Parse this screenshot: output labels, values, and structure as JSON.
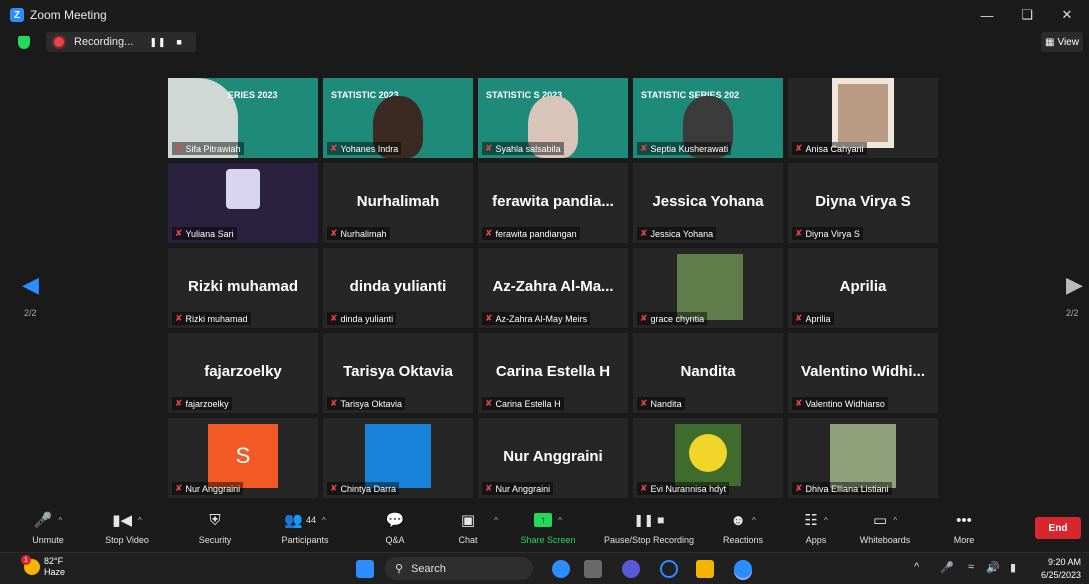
{
  "window": {
    "title": "Zoom Meeting"
  },
  "recording": {
    "label": "Recording..."
  },
  "view_button": {
    "label": "View"
  },
  "pagination": {
    "left": "2/2",
    "right": "2/2"
  },
  "participants": [
    {
      "label": "Sifa Pitrawiah",
      "display": "",
      "slide": "ERIES 2023",
      "kind": "slide"
    },
    {
      "label": "Yohanes Indra",
      "display": "",
      "slide": "STATISTIC  2023",
      "kind": "slide-person"
    },
    {
      "label": "Syahla salsabila",
      "display": "",
      "slide": "STATISTIC   S 2023",
      "kind": "slide-person"
    },
    {
      "label": "Septia Kusherawati",
      "display": "",
      "slide": "STATISTIC SERIES 202",
      "kind": "slide-person"
    },
    {
      "label": "Anisa Cahyani",
      "display": "",
      "slide": "",
      "kind": "photo"
    },
    {
      "label": "Yuliana Sari",
      "display": "",
      "slide": "",
      "kind": "dark"
    },
    {
      "label": "Nurhalimah",
      "display": "Nurhalimah",
      "slide": "",
      "kind": "name"
    },
    {
      "label": "ferawita pandiangan",
      "display": "ferawita pandia...",
      "slide": "",
      "kind": "name"
    },
    {
      "label": "Jessica Yohana",
      "display": "Jessica Yohana",
      "slide": "",
      "kind": "name"
    },
    {
      "label": "Diyna Virya S",
      "display": "Diyna Virya S",
      "slide": "",
      "kind": "name"
    },
    {
      "label": "Rizki muhamad",
      "display": "Rizki muhamad",
      "slide": "",
      "kind": "name"
    },
    {
      "label": "dinda yulianti",
      "display": "dinda yulianti",
      "slide": "",
      "kind": "name"
    },
    {
      "label": "Az-Zahra Al-May Meirs",
      "display": "Az-Zahra Al-Ma...",
      "slide": "",
      "kind": "name"
    },
    {
      "label": "grace chyntia",
      "display": "",
      "slide": "",
      "kind": "photo-green"
    },
    {
      "label": "Aprilia",
      "display": "Aprilia",
      "slide": "",
      "kind": "name"
    },
    {
      "label": "fajarzoelky",
      "display": "fajarzoelky",
      "slide": "",
      "kind": "name"
    },
    {
      "label": "Tarisya Oktavia",
      "display": "Tarisya Oktavia",
      "slide": "",
      "kind": "name"
    },
    {
      "label": "Carina Estella H",
      "display": "Carina Estella H",
      "slide": "",
      "kind": "name"
    },
    {
      "label": "Nandita",
      "display": "Nandita",
      "slide": "",
      "kind": "name"
    },
    {
      "label": "Valentino Widhiarso",
      "display": "Valentino Widhi...",
      "slide": "",
      "kind": "name"
    },
    {
      "label": "Nur Anggraini",
      "display": "",
      "slide": "S",
      "kind": "avatar-orange"
    },
    {
      "label": "Chintya Darra",
      "display": "",
      "slide": "",
      "kind": "avatar-blue"
    },
    {
      "label": "Nur Anggraini",
      "display": "Nur Anggraini",
      "slide": "",
      "kind": "name"
    },
    {
      "label": "Evi Nurannisa hdyt",
      "display": "",
      "slide": "",
      "kind": "flower"
    },
    {
      "label": "Dhiva Elliana Listiani",
      "display": "",
      "slide": "",
      "kind": "photo-garden"
    }
  ],
  "toolbar": {
    "unmute": "Unmute",
    "stop_video": "Stop Video",
    "security": "Security",
    "participants": "Participants",
    "participant_count": "44",
    "qa": "Q&A",
    "chat": "Chat",
    "share": "Share Screen",
    "record": "Pause/Stop Recording",
    "reactions": "Reactions",
    "apps": "Apps",
    "whiteboards": "Whiteboards",
    "more": "More",
    "end": "End"
  },
  "taskbar": {
    "temp": "82°F",
    "weather": "Haze",
    "weather_badge": "1",
    "search": "Search",
    "time": "9:20 AM",
    "date": "6/25/2023"
  }
}
